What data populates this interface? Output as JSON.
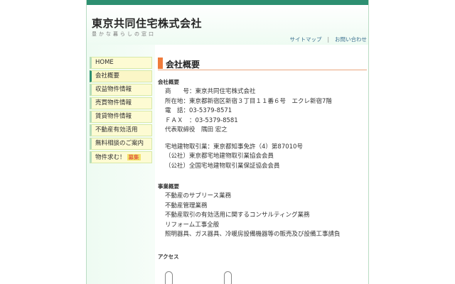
{
  "site": {
    "title": "東京共同住宅株式会社",
    "tagline": "豊かな暮らしの窓口",
    "links": [
      {
        "label": "サイトマップ"
      },
      {
        "label": "お問い合わせ"
      }
    ],
    "link_separator": "|"
  },
  "sidebar": {
    "items": [
      {
        "label": "HOME"
      },
      {
        "label": "会社概要"
      },
      {
        "label": "収益物件情報"
      },
      {
        "label": "売買物件情報"
      },
      {
        "label": "賃貸物件情報"
      },
      {
        "label": "不動産有効活用"
      },
      {
        "label": "無料相談のご案内"
      },
      {
        "label": "物件求む！",
        "badge": "募集"
      }
    ]
  },
  "page": {
    "title": "会社概要",
    "company_heading": "会社概要",
    "company_lines": [
      "商　　号：東京共同住宅株式会社",
      "所在地：東京都新宿区新宿３丁目１１番６号　エクレ新宿7階",
      "電　話：03-5379-8571",
      "ＦＡＸ　：03-5379-8581",
      "代表取締役　隅田 宏之"
    ],
    "license_lines": [
      "宅地建物取引業：東京都知事免許（4）第87010号",
      "（公社）東京都宅地建物取引業協会会員",
      "（公社）全国宅地建物取引業保証協会会員"
    ],
    "business_heading": "事業概要",
    "business_lines": [
      "不動産のサブリース業務",
      "不動産管理業務",
      "不動産取引の有効活用に関するコンサルティング業務",
      "リフォーム工事全般",
      "照明器具、ガス器具、冷暖房設備機器等の販売及び設備工事請負"
    ],
    "access_heading": "アクセス"
  },
  "colors": {
    "accent": "#2d8f71",
    "title_mark": "#ef7b3a",
    "nav_bg": "#fdfbd3"
  }
}
